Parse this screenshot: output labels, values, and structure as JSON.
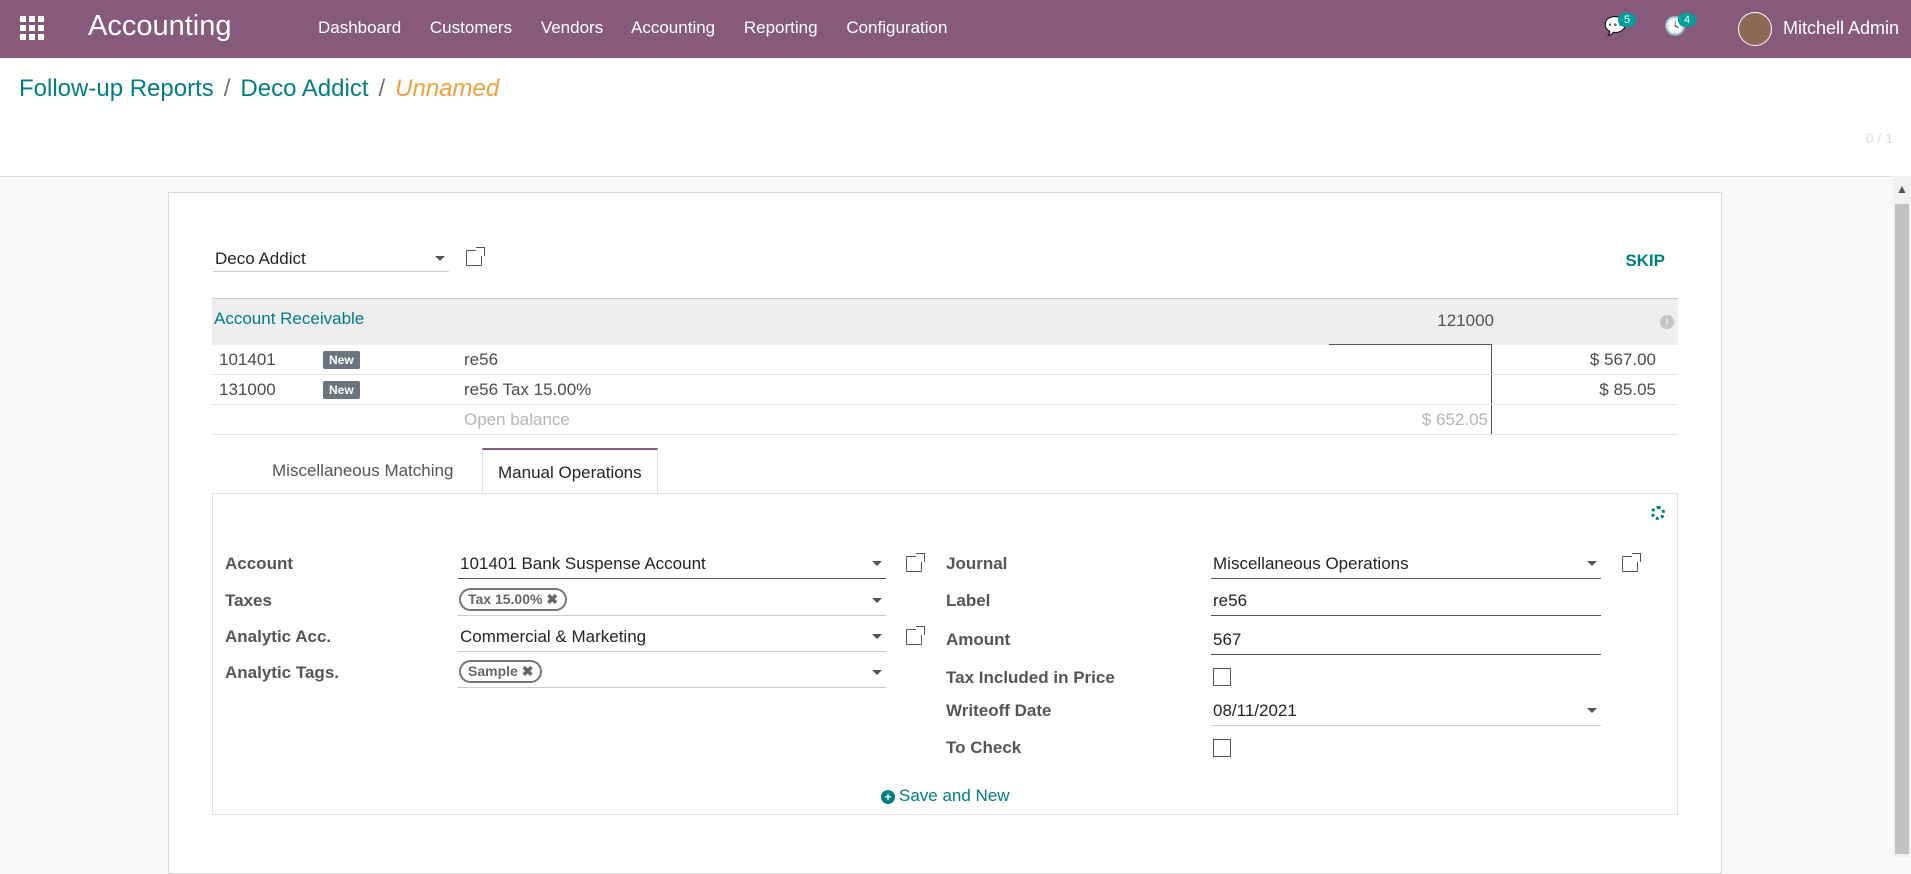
{
  "navbar": {
    "app_title": "Accounting",
    "menu": [
      "Dashboard",
      "Customers",
      "Vendors",
      "Accounting",
      "Reporting",
      "Configuration"
    ],
    "messages_count": "5",
    "activities_count": "4",
    "user_name": "Mitchell Admin"
  },
  "breadcrumb": {
    "root": "Follow-up Reports",
    "sep": "/",
    "partner": "Deco Addict",
    "current": "Unnamed"
  },
  "pager": "0 / 1",
  "reconcile": {
    "partner": "Deco Addict",
    "skip_label": "SKIP",
    "account_title": "Account Receivable",
    "account_code": "121000",
    "info_icon": "i",
    "lines": [
      {
        "account": "101401",
        "badge": "New",
        "label": "re56",
        "amount": "$ 567.00"
      },
      {
        "account": "131000",
        "badge": "New",
        "label": "re56 Tax 15.00%",
        "amount": "$ 85.05"
      }
    ],
    "open_balance_label": "Open balance",
    "open_balance_amount": "$ 652.05"
  },
  "tabs": {
    "misc_matching": "Miscellaneous Matching",
    "manual_operations": "Manual Operations"
  },
  "form": {
    "account_label": "Account",
    "account_value": "101401 Bank Suspense Account",
    "taxes_label": "Taxes",
    "taxes_tag": "Tax 15.00%",
    "analytic_acc_label": "Analytic Acc.",
    "analytic_acc_value": "Commercial & Marketing",
    "analytic_tags_label": "Analytic Tags.",
    "analytic_tag": "Sample",
    "journal_label": "Journal",
    "journal_value": "Miscellaneous Operations",
    "label_label": "Label",
    "label_value": "re56",
    "amount_label": "Amount",
    "amount_value": "567",
    "tax_included_label": "Tax Included in Price",
    "writeoff_date_label": "Writeoff Date",
    "writeoff_date_value": "08/11/2021",
    "to_check_label": "To Check",
    "save_new_label": "Save and New",
    "tag_remove_glyph": "✖"
  },
  "colors": {
    "navbar": "#875a7b",
    "link": "#017e84",
    "breadcrumb_current": "#f0a03f"
  }
}
